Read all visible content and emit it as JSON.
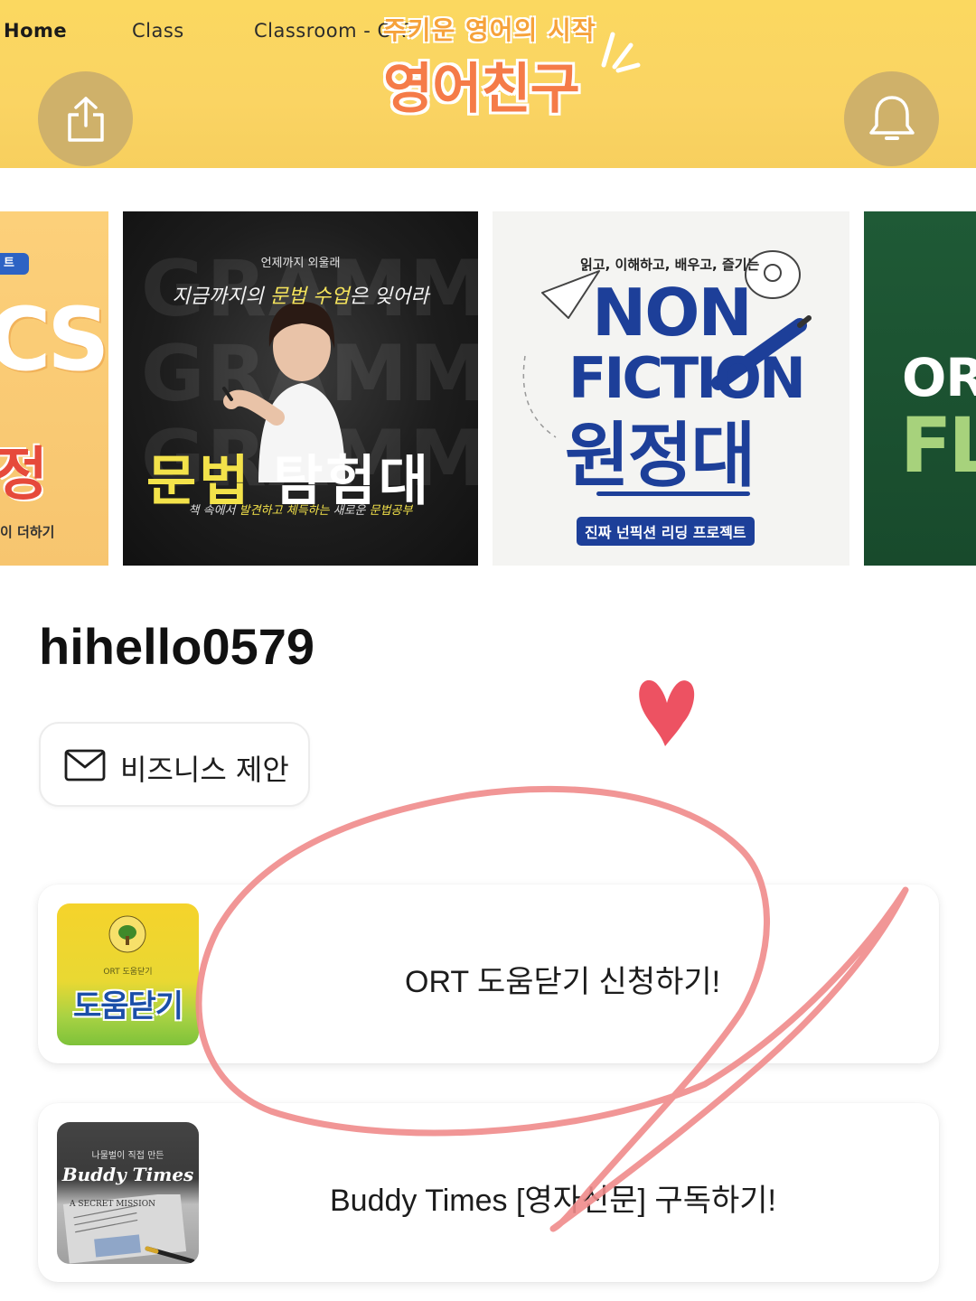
{
  "nav": {
    "home": "Home",
    "class": "Class",
    "classroom": "Classroom - ORT"
  },
  "logo": {
    "subtitle": "주키운 영어의 시작",
    "title": "영어친구"
  },
  "icons": {
    "share": "share-icon",
    "bell": "bell-icon",
    "mail": "mail-icon"
  },
  "banners": [
    {
      "tag": "트",
      "big": "CS",
      "red": "정",
      "foot": "이 더하기"
    },
    {
      "bg_word": "GRAMMAR",
      "tiny": "언제까지 외울래",
      "script_a": "지금까지의 ",
      "script_b": "문법 수업",
      "script_c": "은 잊어라",
      "title_a": "문법",
      "title_b": " 탐험대",
      "foot_a": "책 속에서 ",
      "foot_b": "발견하고 체득하는",
      "foot_c": " 새로운 ",
      "foot_d": "문법공부"
    },
    {
      "top": "읽고, 이해하고, 배우고, 즐기는",
      "non": "NON",
      "fiction": "FICTION",
      "korean": "원정대",
      "pill": "진짜 넌픽션 리딩 프로젝트"
    },
    {
      "or": "OR",
      "fly": "FLY"
    }
  ],
  "profile": {
    "username": "hihello0579",
    "business_button": "비즈니스 제안"
  },
  "links": [
    {
      "thumb_title": "도움닫기",
      "thumb_sub": "ORT 도움닫기",
      "label": "ORT 도움닫기 신청하기!"
    },
    {
      "thumb_small": "나물벌이 직접 만든",
      "thumb_title": "Buddy Times",
      "thumb_news": "A SECRET MISSION",
      "label": "Buddy Times [영자신문] 구독하기!"
    }
  ],
  "colors": {
    "header_bg": "#fad463",
    "circle_button": "#cfb16a",
    "doodle_stroke": "#f08b8b",
    "heart": "#ea3a4c"
  }
}
